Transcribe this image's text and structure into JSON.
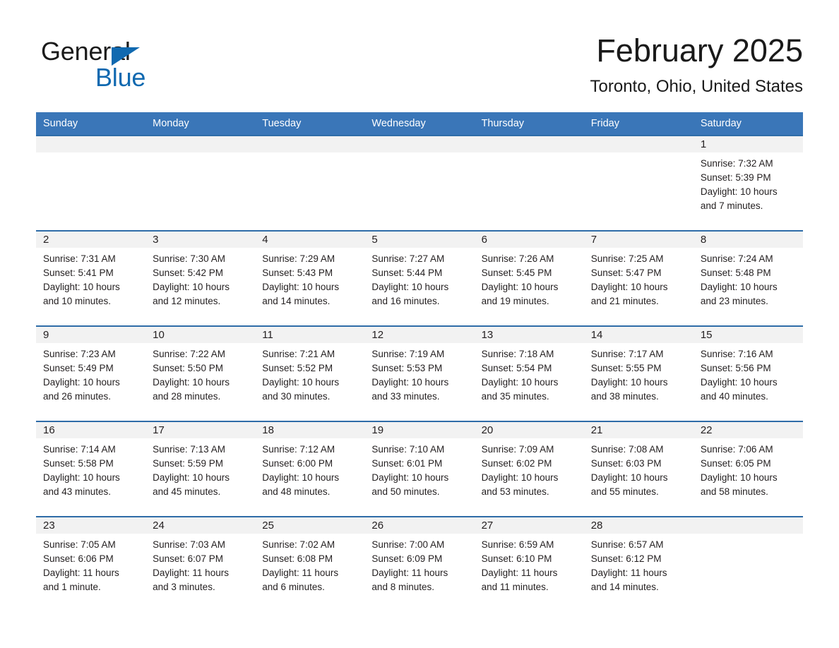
{
  "brand": {
    "line1": "General",
    "line2": "Blue",
    "triangle_color": "#1069b0"
  },
  "header": {
    "title": "February 2025",
    "subtitle": "Toronto, Ohio, United States"
  },
  "colors": {
    "header_blue": "#3a76b8",
    "row_rule_blue": "#2e6ca8",
    "daynum_band": "#f2f2f2",
    "text": "#231f20"
  },
  "labels": {
    "sunrise_prefix": "Sunrise:",
    "sunset_prefix": "Sunset:",
    "daylight_prefix": "Daylight:"
  },
  "weekday_headers": [
    "Sunday",
    "Monday",
    "Tuesday",
    "Wednesday",
    "Thursday",
    "Friday",
    "Saturday"
  ],
  "weeks": [
    [
      {
        "day": "",
        "sunrise": "",
        "sunset": "",
        "daylight_line1": "",
        "daylight_line2": ""
      },
      {
        "day": "",
        "sunrise": "",
        "sunset": "",
        "daylight_line1": "",
        "daylight_line2": ""
      },
      {
        "day": "",
        "sunrise": "",
        "sunset": "",
        "daylight_line1": "",
        "daylight_line2": ""
      },
      {
        "day": "",
        "sunrise": "",
        "sunset": "",
        "daylight_line1": "",
        "daylight_line2": ""
      },
      {
        "day": "",
        "sunrise": "",
        "sunset": "",
        "daylight_line1": "",
        "daylight_line2": ""
      },
      {
        "day": "",
        "sunrise": "",
        "sunset": "",
        "daylight_line1": "",
        "daylight_line2": ""
      },
      {
        "day": "1",
        "sunrise": "Sunrise: 7:32 AM",
        "sunset": "Sunset: 5:39 PM",
        "daylight_line1": "Daylight: 10 hours",
        "daylight_line2": "and 7 minutes."
      }
    ],
    [
      {
        "day": "2",
        "sunrise": "Sunrise: 7:31 AM",
        "sunset": "Sunset: 5:41 PM",
        "daylight_line1": "Daylight: 10 hours",
        "daylight_line2": "and 10 minutes."
      },
      {
        "day": "3",
        "sunrise": "Sunrise: 7:30 AM",
        "sunset": "Sunset: 5:42 PM",
        "daylight_line1": "Daylight: 10 hours",
        "daylight_line2": "and 12 minutes."
      },
      {
        "day": "4",
        "sunrise": "Sunrise: 7:29 AM",
        "sunset": "Sunset: 5:43 PM",
        "daylight_line1": "Daylight: 10 hours",
        "daylight_line2": "and 14 minutes."
      },
      {
        "day": "5",
        "sunrise": "Sunrise: 7:27 AM",
        "sunset": "Sunset: 5:44 PM",
        "daylight_line1": "Daylight: 10 hours",
        "daylight_line2": "and 16 minutes."
      },
      {
        "day": "6",
        "sunrise": "Sunrise: 7:26 AM",
        "sunset": "Sunset: 5:45 PM",
        "daylight_line1": "Daylight: 10 hours",
        "daylight_line2": "and 19 minutes."
      },
      {
        "day": "7",
        "sunrise": "Sunrise: 7:25 AM",
        "sunset": "Sunset: 5:47 PM",
        "daylight_line1": "Daylight: 10 hours",
        "daylight_line2": "and 21 minutes."
      },
      {
        "day": "8",
        "sunrise": "Sunrise: 7:24 AM",
        "sunset": "Sunset: 5:48 PM",
        "daylight_line1": "Daylight: 10 hours",
        "daylight_line2": "and 23 minutes."
      }
    ],
    [
      {
        "day": "9",
        "sunrise": "Sunrise: 7:23 AM",
        "sunset": "Sunset: 5:49 PM",
        "daylight_line1": "Daylight: 10 hours",
        "daylight_line2": "and 26 minutes."
      },
      {
        "day": "10",
        "sunrise": "Sunrise: 7:22 AM",
        "sunset": "Sunset: 5:50 PM",
        "daylight_line1": "Daylight: 10 hours",
        "daylight_line2": "and 28 minutes."
      },
      {
        "day": "11",
        "sunrise": "Sunrise: 7:21 AM",
        "sunset": "Sunset: 5:52 PM",
        "daylight_line1": "Daylight: 10 hours",
        "daylight_line2": "and 30 minutes."
      },
      {
        "day": "12",
        "sunrise": "Sunrise: 7:19 AM",
        "sunset": "Sunset: 5:53 PM",
        "daylight_line1": "Daylight: 10 hours",
        "daylight_line2": "and 33 minutes."
      },
      {
        "day": "13",
        "sunrise": "Sunrise: 7:18 AM",
        "sunset": "Sunset: 5:54 PM",
        "daylight_line1": "Daylight: 10 hours",
        "daylight_line2": "and 35 minutes."
      },
      {
        "day": "14",
        "sunrise": "Sunrise: 7:17 AM",
        "sunset": "Sunset: 5:55 PM",
        "daylight_line1": "Daylight: 10 hours",
        "daylight_line2": "and 38 minutes."
      },
      {
        "day": "15",
        "sunrise": "Sunrise: 7:16 AM",
        "sunset": "Sunset: 5:56 PM",
        "daylight_line1": "Daylight: 10 hours",
        "daylight_line2": "and 40 minutes."
      }
    ],
    [
      {
        "day": "16",
        "sunrise": "Sunrise: 7:14 AM",
        "sunset": "Sunset: 5:58 PM",
        "daylight_line1": "Daylight: 10 hours",
        "daylight_line2": "and 43 minutes."
      },
      {
        "day": "17",
        "sunrise": "Sunrise: 7:13 AM",
        "sunset": "Sunset: 5:59 PM",
        "daylight_line1": "Daylight: 10 hours",
        "daylight_line2": "and 45 minutes."
      },
      {
        "day": "18",
        "sunrise": "Sunrise: 7:12 AM",
        "sunset": "Sunset: 6:00 PM",
        "daylight_line1": "Daylight: 10 hours",
        "daylight_line2": "and 48 minutes."
      },
      {
        "day": "19",
        "sunrise": "Sunrise: 7:10 AM",
        "sunset": "Sunset: 6:01 PM",
        "daylight_line1": "Daylight: 10 hours",
        "daylight_line2": "and 50 minutes."
      },
      {
        "day": "20",
        "sunrise": "Sunrise: 7:09 AM",
        "sunset": "Sunset: 6:02 PM",
        "daylight_line1": "Daylight: 10 hours",
        "daylight_line2": "and 53 minutes."
      },
      {
        "day": "21",
        "sunrise": "Sunrise: 7:08 AM",
        "sunset": "Sunset: 6:03 PM",
        "daylight_line1": "Daylight: 10 hours",
        "daylight_line2": "and 55 minutes."
      },
      {
        "day": "22",
        "sunrise": "Sunrise: 7:06 AM",
        "sunset": "Sunset: 6:05 PM",
        "daylight_line1": "Daylight: 10 hours",
        "daylight_line2": "and 58 minutes."
      }
    ],
    [
      {
        "day": "23",
        "sunrise": "Sunrise: 7:05 AM",
        "sunset": "Sunset: 6:06 PM",
        "daylight_line1": "Daylight: 11 hours",
        "daylight_line2": "and 1 minute."
      },
      {
        "day": "24",
        "sunrise": "Sunrise: 7:03 AM",
        "sunset": "Sunset: 6:07 PM",
        "daylight_line1": "Daylight: 11 hours",
        "daylight_line2": "and 3 minutes."
      },
      {
        "day": "25",
        "sunrise": "Sunrise: 7:02 AM",
        "sunset": "Sunset: 6:08 PM",
        "daylight_line1": "Daylight: 11 hours",
        "daylight_line2": "and 6 minutes."
      },
      {
        "day": "26",
        "sunrise": "Sunrise: 7:00 AM",
        "sunset": "Sunset: 6:09 PM",
        "daylight_line1": "Daylight: 11 hours",
        "daylight_line2": "and 8 minutes."
      },
      {
        "day": "27",
        "sunrise": "Sunrise: 6:59 AM",
        "sunset": "Sunset: 6:10 PM",
        "daylight_line1": "Daylight: 11 hours",
        "daylight_line2": "and 11 minutes."
      },
      {
        "day": "28",
        "sunrise": "Sunrise: 6:57 AM",
        "sunset": "Sunset: 6:12 PM",
        "daylight_line1": "Daylight: 11 hours",
        "daylight_line2": "and 14 minutes."
      },
      {
        "day": "",
        "sunrise": "",
        "sunset": "",
        "daylight_line1": "",
        "daylight_line2": ""
      }
    ]
  ]
}
